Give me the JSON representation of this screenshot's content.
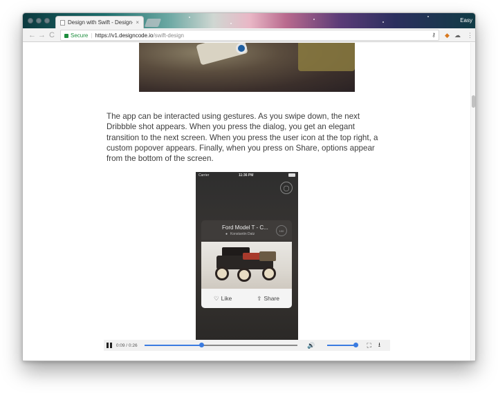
{
  "browser": {
    "tab_title": "Design with Swift - Design+Co",
    "tab_close": "×",
    "profile_name": "Easy",
    "nav": {
      "back": "←",
      "forward": "→",
      "reload": "C"
    },
    "omnibox": {
      "secure_label": "Secure",
      "separator": "|",
      "url_main": "https://v1.designcode.io",
      "url_path": "/swift-design",
      "key_icon": "key-icon"
    },
    "extensions": [
      "fox-extension-icon",
      "cloud-extension-icon",
      "menu-kebab-icon"
    ]
  },
  "article": {
    "paragraph": "The app can be interacted using gestures. As you swipe down, the next Dribbble shot appears. When you press the dialog, you get an elegant transition to the next screen. When you press the user icon at the top right, a custom popover appears. Finally, when you press on Share, options appear from the bottom of the screen."
  },
  "phone": {
    "carrier": "Carrier",
    "time": "11:36 PM",
    "card_title": "Ford Model T - C...",
    "card_author": "Konstantin Datz",
    "badge_text": "100",
    "like_label": "Like",
    "share_label": "Share"
  },
  "video": {
    "time": "0:09 / 0:26",
    "progress": 0.37,
    "volume": 1.0
  },
  "colors": {
    "accent": "#3a7be0",
    "secure_green": "#1e8e3e",
    "text": "#3c3c3c"
  }
}
